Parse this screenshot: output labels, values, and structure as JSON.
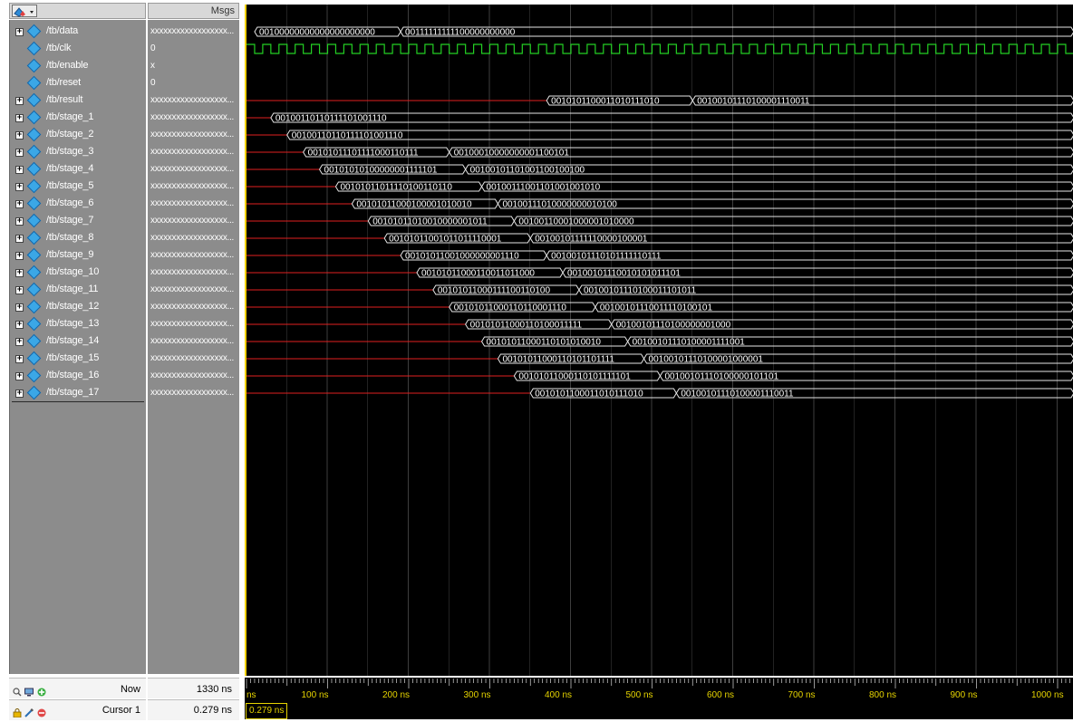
{
  "header": {
    "msgs_label": "Msgs"
  },
  "signals": [
    {
      "name": "/tb/data",
      "value": "xxxxxxxxxxxxxxxxxx...",
      "expandable": true,
      "type": "bus",
      "segments": [
        {
          "t0": 10,
          "t1": 190,
          "label": "00100000000000000000000"
        },
        {
          "t0": 190,
          "t1": 1020,
          "label": "00111111111100000000000"
        }
      ]
    },
    {
      "name": "/tb/clk",
      "value": "0",
      "expandable": false,
      "type": "clock",
      "period": 20
    },
    {
      "name": "/tb/enable",
      "value": "x",
      "expandable": false,
      "type": "x"
    },
    {
      "name": "/tb/reset",
      "value": "0",
      "expandable": false,
      "type": "x"
    },
    {
      "name": "/tb/result",
      "value": "xxxxxxxxxxxxxxxxxx...",
      "expandable": true,
      "type": "bus",
      "redEnd": 370,
      "segments": [
        {
          "t0": 370,
          "t1": 550,
          "label": "0010101100011010111010"
        },
        {
          "t0": 550,
          "t1": 1020,
          "label": "00100101110100001110011"
        }
      ]
    },
    {
      "name": "/tb/stage_1",
      "value": "xxxxxxxxxxxxxxxxxx...",
      "expandable": true,
      "type": "bus",
      "redEnd": 30,
      "segments": [
        {
          "t0": 30,
          "t1": 1020,
          "label": "00100110110111101001110"
        }
      ]
    },
    {
      "name": "/tb/stage_2",
      "value": "xxxxxxxxxxxxxxxxxx...",
      "expandable": true,
      "type": "bus",
      "redEnd": 50,
      "segments": [
        {
          "t0": 50,
          "t1": 1020,
          "label": "00100110110111101001110"
        }
      ]
    },
    {
      "name": "/tb/stage_3",
      "value": "xxxxxxxxxxxxxxxxxx...",
      "expandable": true,
      "type": "bus",
      "redEnd": 70,
      "segments": [
        {
          "t0": 70,
          "t1": 250,
          "label": "00101011101111000110111"
        },
        {
          "t0": 250,
          "t1": 1020,
          "label": "00100010000000001100101"
        }
      ]
    },
    {
      "name": "/tb/stage_4",
      "value": "xxxxxxxxxxxxxxxxxx...",
      "expandable": true,
      "type": "bus",
      "redEnd": 90,
      "segments": [
        {
          "t0": 90,
          "t1": 270,
          "label": "00101010100000001111101"
        },
        {
          "t0": 270,
          "t1": 1020,
          "label": "00100101101001100100100"
        }
      ]
    },
    {
      "name": "/tb/stage_5",
      "value": "xxxxxxxxxxxxxxxxxx...",
      "expandable": true,
      "type": "bus",
      "redEnd": 110,
      "segments": [
        {
          "t0": 110,
          "t1": 290,
          "label": "00101011011110100110110"
        },
        {
          "t0": 290,
          "t1": 1020,
          "label": "00100111001101001001010"
        }
      ]
    },
    {
      "name": "/tb/stage_6",
      "value": "xxxxxxxxxxxxxxxxxx...",
      "expandable": true,
      "type": "bus",
      "redEnd": 130,
      "segments": [
        {
          "t0": 130,
          "t1": 310,
          "label": "00101011000100001010010"
        },
        {
          "t0": 310,
          "t1": 1020,
          "label": "00100111010000000010100"
        }
      ]
    },
    {
      "name": "/tb/stage_7",
      "value": "xxxxxxxxxxxxxxxxxx...",
      "expandable": true,
      "type": "bus",
      "redEnd": 150,
      "segments": [
        {
          "t0": 150,
          "t1": 330,
          "label": "00101011010010000001011"
        },
        {
          "t0": 330,
          "t1": 1020,
          "label": "00100110001000001010000"
        }
      ]
    },
    {
      "name": "/tb/stage_8",
      "value": "xxxxxxxxxxxxxxxxxx...",
      "expandable": true,
      "type": "bus",
      "redEnd": 170,
      "segments": [
        {
          "t0": 170,
          "t1": 350,
          "label": "00101011001011011110001"
        },
        {
          "t0": 350,
          "t1": 1020,
          "label": "00100101111110000100001"
        }
      ]
    },
    {
      "name": "/tb/stage_9",
      "value": "xxxxxxxxxxxxxxxxxx...",
      "expandable": true,
      "type": "bus",
      "redEnd": 190,
      "segments": [
        {
          "t0": 190,
          "t1": 370,
          "label": "00101011001000000001110"
        },
        {
          "t0": 370,
          "t1": 1020,
          "label": "00100101110101111110111"
        }
      ]
    },
    {
      "name": "/tb/stage_10",
      "value": "xxxxxxxxxxxxxxxxxx...",
      "expandable": true,
      "type": "bus",
      "redEnd": 210,
      "segments": [
        {
          "t0": 210,
          "t1": 390,
          "label": "00101011000110011011000"
        },
        {
          "t0": 390,
          "t1": 1020,
          "label": "00100101110010101011101"
        }
      ]
    },
    {
      "name": "/tb/stage_11",
      "value": "xxxxxxxxxxxxxxxxxx...",
      "expandable": true,
      "type": "bus",
      "redEnd": 230,
      "segments": [
        {
          "t0": 230,
          "t1": 410,
          "label": "00101011000111100110100"
        },
        {
          "t0": 410,
          "t1": 1020,
          "label": "00100101110100011101011"
        }
      ]
    },
    {
      "name": "/tb/stage_12",
      "value": "xxxxxxxxxxxxxxxxxx...",
      "expandable": true,
      "type": "bus",
      "redEnd": 250,
      "segments": [
        {
          "t0": 250,
          "t1": 430,
          "label": "00101011000110110001110"
        },
        {
          "t0": 430,
          "t1": 1020,
          "label": "00100101110011110100101"
        }
      ]
    },
    {
      "name": "/tb/stage_13",
      "value": "xxxxxxxxxxxxxxxxxx...",
      "expandable": true,
      "type": "bus",
      "redEnd": 270,
      "segments": [
        {
          "t0": 270,
          "t1": 450,
          "label": "00101011000110100011111"
        },
        {
          "t0": 450,
          "t1": 1020,
          "label": "00100101110100000001000"
        }
      ]
    },
    {
      "name": "/tb/stage_14",
      "value": "xxxxxxxxxxxxxxxxxx...",
      "expandable": true,
      "type": "bus",
      "redEnd": 290,
      "segments": [
        {
          "t0": 290,
          "t1": 470,
          "label": "00101011000110101010010"
        },
        {
          "t0": 470,
          "t1": 1020,
          "label": "00100101110100001111001"
        }
      ]
    },
    {
      "name": "/tb/stage_15",
      "value": "xxxxxxxxxxxxxxxxxx...",
      "expandable": true,
      "type": "bus",
      "redEnd": 310,
      "segments": [
        {
          "t0": 310,
          "t1": 490,
          "label": "00101011000110101101111"
        },
        {
          "t0": 490,
          "t1": 1020,
          "label": "00100101110100001000001"
        }
      ]
    },
    {
      "name": "/tb/stage_16",
      "value": "xxxxxxxxxxxxxxxxxx...",
      "expandable": true,
      "type": "bus",
      "redEnd": 330,
      "segments": [
        {
          "t0": 330,
          "t1": 510,
          "label": "00101011000110101111101"
        },
        {
          "t0": 510,
          "t1": 1020,
          "label": "00100101110100000101101"
        }
      ]
    },
    {
      "name": "/tb/stage_17",
      "value": "xxxxxxxxxxxxxxxxxx...",
      "expandable": true,
      "type": "bus",
      "redEnd": 350,
      "segments": [
        {
          "t0": 350,
          "t1": 530,
          "label": "0010101100011010111010"
        },
        {
          "t0": 530,
          "t1": 1020,
          "label": "00100101110100001110011"
        }
      ]
    }
  ],
  "timeline": {
    "now_label": "Now",
    "now_value": "1330 ns",
    "cursor_label": "Cursor 1",
    "cursor_value": "0.279 ns",
    "cursor_tag": "0.279 ns",
    "ticks": [
      "ns",
      "100 ns",
      "200 ns",
      "300 ns",
      "400 ns",
      "500 ns",
      "600 ns",
      "700 ns",
      "800 ns",
      "900 ns",
      "1000 ns"
    ],
    "tick_values_ns": [
      0,
      100,
      200,
      300,
      400,
      500,
      600,
      700,
      800,
      900,
      1000
    ]
  },
  "colors": {
    "wave_bus": "#e6e6e6",
    "wave_clock": "#23d023",
    "wave_x_red": "#e02020",
    "cursor": "#f0d000",
    "ruler_text": "#e6d400",
    "grid": "#3a3a3a",
    "signal_icon": "#3ba7e6"
  },
  "icons": {
    "header_button": "signal-select-icon",
    "signal": "signal-diamond-icon",
    "expand": "expand-plus-icon",
    "now_tools": [
      "zoom-icon",
      "monitor-icon",
      "add-cursor-icon"
    ],
    "cursor_tools": [
      "lock-icon",
      "edit-icon",
      "remove-cursor-icon"
    ]
  }
}
